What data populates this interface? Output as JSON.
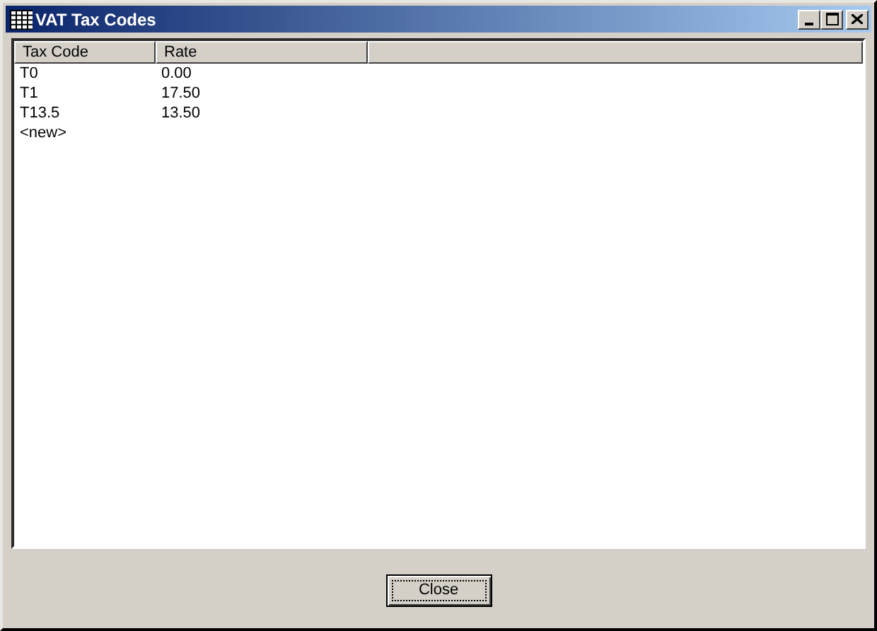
{
  "window": {
    "title": "VAT Tax Codes"
  },
  "table": {
    "columns": [
      "Tax Code",
      "Rate"
    ],
    "rows": [
      {
        "cells": [
          "T0",
          "0.00"
        ]
      },
      {
        "cells": [
          "T1",
          "17.50"
        ]
      },
      {
        "cells": [
          "T13.5",
          "13.50"
        ]
      },
      {
        "cells": [
          "<new>"
        ]
      }
    ]
  },
  "buttons": [
    "Close"
  ]
}
